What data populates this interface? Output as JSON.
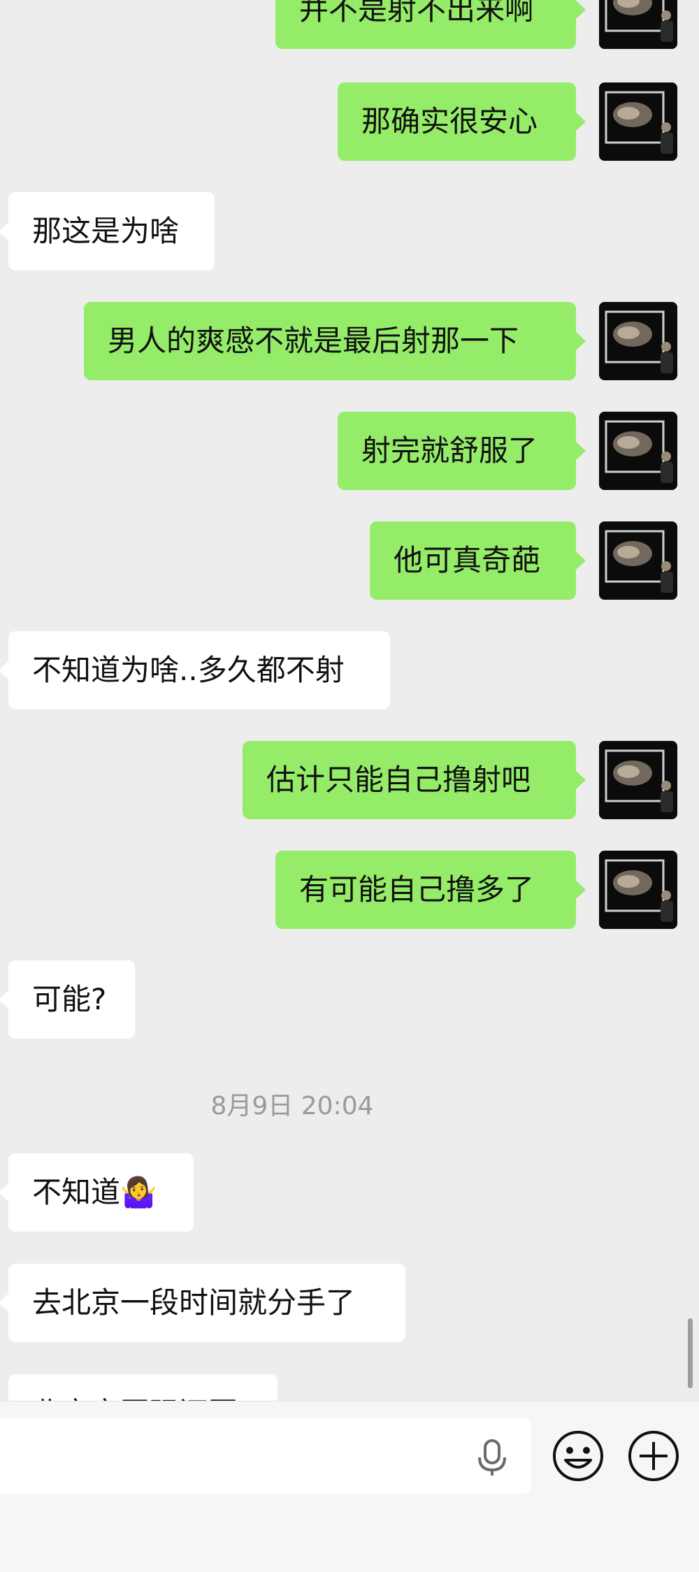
{
  "messages": [
    {
      "side": "out",
      "text": "并不是射不出来啊"
    },
    {
      "side": "out",
      "text": "那确实很安心"
    },
    {
      "side": "in",
      "text": "那这是为啥"
    },
    {
      "side": "out",
      "text": "男人的爽感不就是最后射那一下"
    },
    {
      "side": "out",
      "text": "射完就舒服了"
    },
    {
      "side": "out",
      "text": "他可真奇葩"
    },
    {
      "side": "in",
      "text": "不知道为啥..多久都不射"
    },
    {
      "side": "out",
      "text": "估计只能自己撸射吧"
    },
    {
      "side": "out",
      "text": "有可能自己撸多了"
    },
    {
      "side": "in",
      "text": "可能?"
    },
    {
      "side": "in",
      "text": "不知道🤷‍♀️"
    },
    {
      "side": "in",
      "text": "去北京一段时间就分手了"
    },
    {
      "side": "in",
      "text": "北京市国强还回"
    }
  ],
  "timestamp": "8月9日 20:04",
  "colors": {
    "outgoing_bubble": "#95ec69",
    "incoming_bubble": "#ffffff",
    "background": "#ededed"
  },
  "input_bar": {
    "mic_icon": "microphone-icon",
    "emoji_icon": "smiley-face-icon",
    "plus_icon": "plus-circle-icon"
  }
}
